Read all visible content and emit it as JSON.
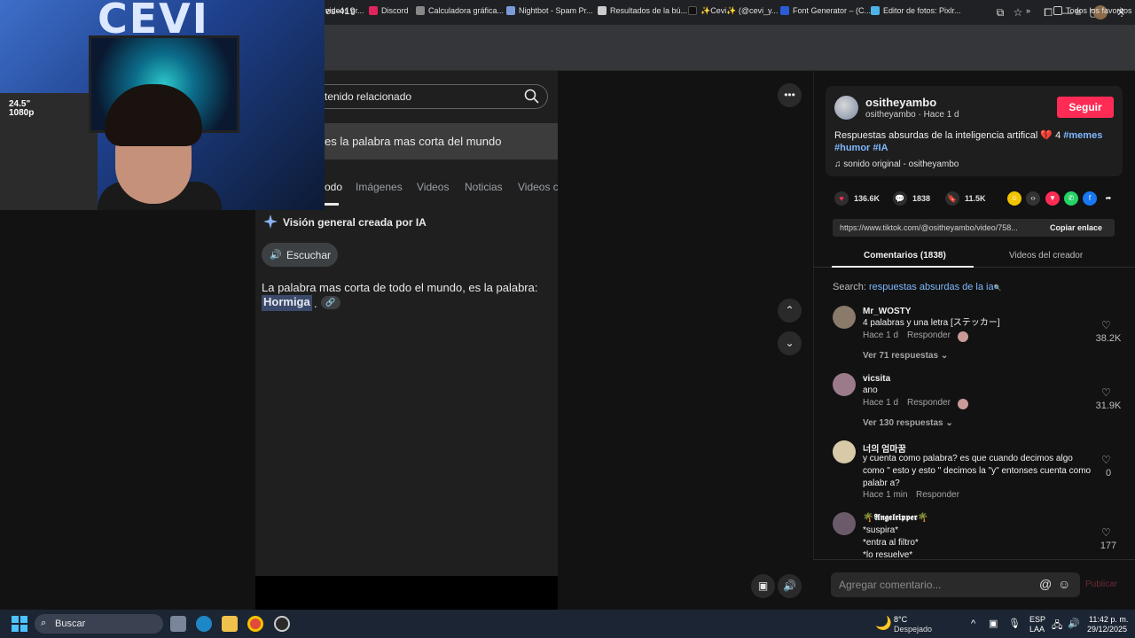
{
  "browser": {
    "url_fragment": "es-419",
    "window_controls": [
      "—",
      "▢",
      "✕"
    ],
    "bookmarks": [
      {
        "label": "videos gr...",
        "color": "#888888"
      },
      {
        "label": "Discord",
        "color": "#e0245e"
      },
      {
        "label": "Calculadora gráfica...",
        "color": "#888888"
      },
      {
        "label": "Nightbot - Spam Pr...",
        "color": "#7a9bd8"
      },
      {
        "label": "Resultados de la bú...",
        "color": "#cccccc"
      },
      {
        "label": "✨Cevi✨ (@cevi_y...",
        "color": "#111111"
      },
      {
        "label": "Font Generator – (C...",
        "color": "#2b5bd7"
      },
      {
        "label": "Editor de fotos: Pixlr...",
        "color": "#4fb3e8"
      }
    ],
    "all_favorites": "Todos los favoritos"
  },
  "webcam": {
    "logo_text": "CEVI",
    "monitor_badge_line1": "24.5\"",
    "monitor_badge_line2": "1080p"
  },
  "google": {
    "search_text": "tenido relacionado",
    "query": "es la palabra mas corta del mundo",
    "tabs": [
      "odo",
      "Imágenes",
      "Videos",
      "Noticias",
      "Videos c"
    ],
    "ai_overview_title": "Visión general creada por IA",
    "listen_label": "Escuchar",
    "answer_text": "La palabra mas corta de todo el mundo, es la palabra:",
    "answer_highlight": "Hormiga",
    "answer_dot": "."
  },
  "video_controls": {
    "more": "•••",
    "up": "⌃",
    "down": "⌄"
  },
  "post": {
    "author": "ositheyambo",
    "author_sub": "ositheyambo · Hace 1 d",
    "follow_label": "Seguir",
    "caption_text": "Respuestas absurdas de la inteligencia artifical 💔 4 ",
    "caption_tags_1": "#memes",
    "caption_tags_2": "#humor #IA",
    "sound": "sonido original - ositheyambo",
    "likes": "136.6K",
    "comments_count": "1838",
    "saves": "11.5K",
    "link": "https://www.tiktok.com/@ositheyambo/video/758...",
    "copy_link_label": "Copiar enlace",
    "tab_comments": "Comentarios (1838)",
    "tab_videos": "Videos del creador",
    "search_prefix": "Search: ",
    "search_term": "respuestas absurdas de la ia",
    "accent_color": "#fe2c55"
  },
  "comments": [
    {
      "name": "Mr_WOSTY",
      "text": "4 palabras y una letra [ステッカー]",
      "time": "Hace 1 d",
      "reply": "Responder",
      "likes": "38.2K",
      "replies": "Ver 71 respuestas",
      "avatar_color": "#8a7a6a"
    },
    {
      "name": "vicsita",
      "text": "ano",
      "time": "Hace 1 d",
      "reply": "Responder",
      "likes": "31.9K",
      "replies": "Ver 130 respuestas",
      "avatar_color": "#9b7b8a"
    },
    {
      "name": "너의 엄마꿈",
      "text": "y cuenta como palabra? es que cuando decimos algo como \" esto y esto \" decimos la \"y\" entonses cuenta como palabr a?",
      "time": "Hace 1 min",
      "reply": "Responder",
      "likes": "0",
      "avatar_color": "#d8c9a8"
    },
    {
      "name": "🌴𝕬𝖓𝖌𝖊𝖑𝖗𝖎𝖕𝖕𝖊𝖗🌴",
      "text": "*suspira*\n*entra al filtro*\n*lo resuelve*",
      "likes": "177",
      "avatar_color": "#6a5a6a"
    }
  ],
  "comment_box": {
    "placeholder": "Agregar comentario...",
    "publish_label": "Publicar"
  },
  "taskbar": {
    "search_label": "Buscar",
    "weather_temp": "8°C",
    "weather_desc": "Despejado",
    "lang_1": "ESP",
    "lang_2": "LAA",
    "time": "11:42 p. m.",
    "date": "29/12/2025"
  }
}
